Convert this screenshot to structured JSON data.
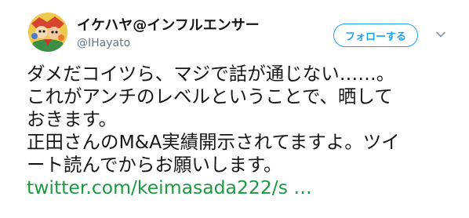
{
  "author": {
    "display_name": "イケハヤ@インフルエンサー",
    "handle": "@IHayato",
    "avatar_icon": "avatar-illustration"
  },
  "follow_button": {
    "label": "フォローする",
    "color": "#1da1f2"
  },
  "menu_icon": "chevron-down-icon",
  "tweet": {
    "lines": [
      "ダメだコイツら、マジで話が通じない……。",
      "これがアンチのレベルということで、晒して",
      "おきます。",
      "正田さんのM&A実績開示されてますよ。ツイ",
      "ート読んでからお願いします。"
    ],
    "link_text": "twitter.com/keimasada222/s …",
    "link_color": "#1a9a3f"
  }
}
